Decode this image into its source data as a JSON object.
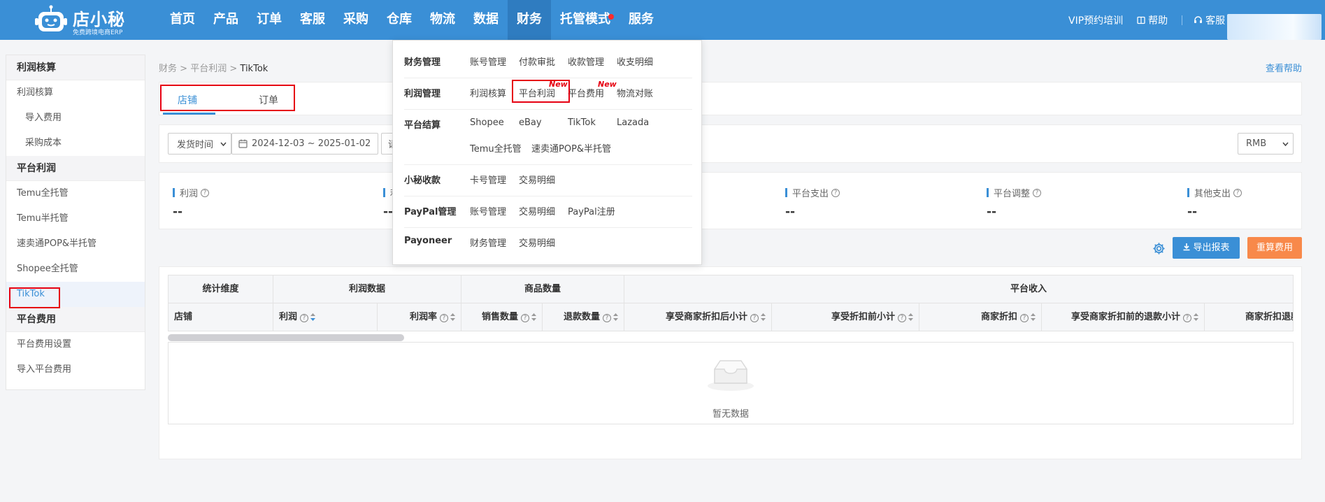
{
  "header": {
    "brand": "店小秘",
    "brand_sub": "免费跨境电商ERP",
    "nav": [
      "首页",
      "产品",
      "订单",
      "客服",
      "采购",
      "仓库",
      "物流",
      "数据",
      "财务",
      "托管模式",
      "服务"
    ],
    "active_nav": "财务",
    "vip": "VIP预约培训",
    "help": "帮助",
    "service": "客服"
  },
  "sidebar": {
    "groups": [
      {
        "title": "利润核算",
        "items": [
          {
            "label": "利润核算"
          },
          {
            "label": "导入费用"
          },
          {
            "label": "采购成本"
          }
        ]
      },
      {
        "title": "平台利润",
        "items": [
          {
            "label": "Temu全托管"
          },
          {
            "label": "Temu半托管"
          },
          {
            "label": "速卖通POP&半托管"
          },
          {
            "label": "Shopee全托管"
          },
          {
            "label": "TikTok"
          }
        ]
      },
      {
        "title": "平台费用",
        "items": [
          {
            "label": "平台费用设置"
          },
          {
            "label": "导入平台费用"
          }
        ]
      }
    ],
    "active": "TikTok"
  },
  "breadcrumb": {
    "a": "财务",
    "b": "平台利润",
    "c": "TikTok",
    "sep": ">"
  },
  "help_link": "查看帮助",
  "tabs": {
    "store": "店铺",
    "order": "订单"
  },
  "filters": {
    "date_type": "发货时间",
    "date_range": "2024-12-03 ~ 2025-01-02",
    "third": "请",
    "currency": "RMB"
  },
  "stats": [
    {
      "label": "利润",
      "value": "--"
    },
    {
      "label": "利",
      "value": "--"
    },
    {
      "label": "平台支出",
      "value": "--"
    },
    {
      "label": "平台调整",
      "value": "--"
    },
    {
      "label": "其他支出",
      "value": "--"
    }
  ],
  "buttons": {
    "export": "导出报表",
    "recalc": "重算费用"
  },
  "table": {
    "groups": [
      "统计维度",
      "利润数据",
      "商品数量",
      "平台收入"
    ],
    "columns": [
      "店铺",
      "利润",
      "利润率",
      "销售数量",
      "退款数量",
      "享受商家折扣后小计",
      "享受折扣前小计",
      "商家折扣",
      "享受商家折扣前的退款小计",
      "商家折扣退款"
    ],
    "empty": "暂无数据"
  },
  "dropdown": {
    "rows": [
      {
        "label": "财务管理",
        "links": [
          "账号管理",
          "付款审批",
          "收款管理",
          "收支明细"
        ]
      },
      {
        "label": "利润管理",
        "links": [
          "利润核算",
          "平台利润",
          "平台费用",
          "物流对账"
        ]
      },
      {
        "label": "平台结算",
        "links": [
          "Shopee",
          "eBay",
          "TikTok",
          "Lazada",
          "Temu全托管",
          "速卖通POP&半托管"
        ]
      },
      {
        "label": "小秘收款",
        "links": [
          "卡号管理",
          "交易明细"
        ]
      },
      {
        "label": "PayPal管理",
        "links": [
          "账号管理",
          "交易明细",
          "PayPal注册"
        ]
      },
      {
        "label": "Payoneer",
        "links": [
          "财务管理",
          "交易明细"
        ]
      }
    ],
    "new_tag": "New"
  }
}
